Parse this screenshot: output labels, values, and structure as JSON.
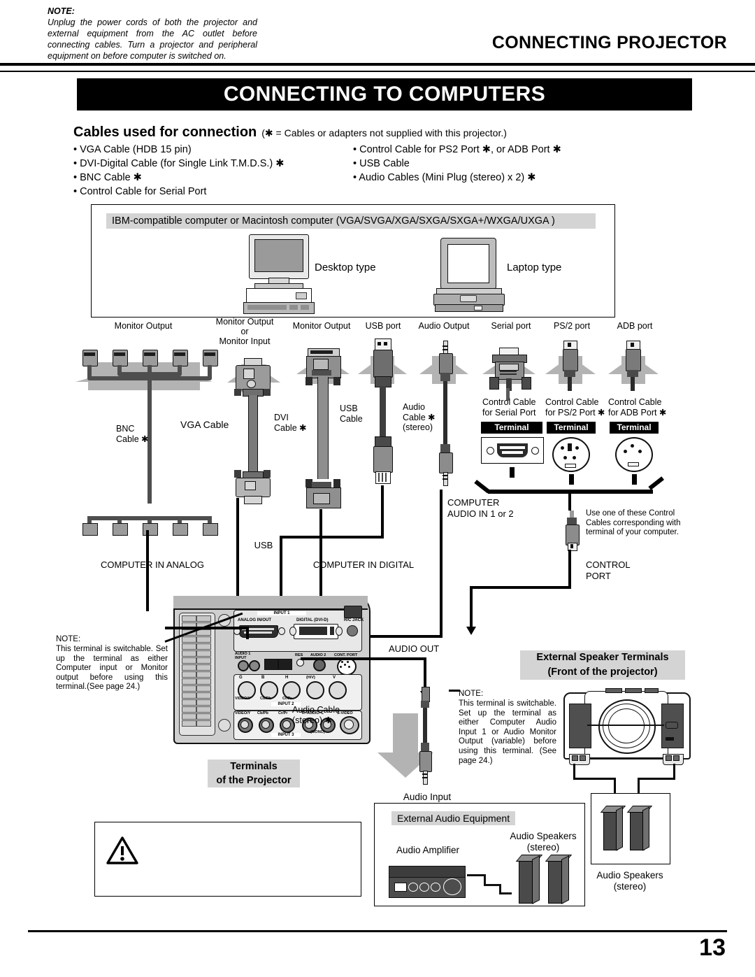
{
  "header": {
    "title": "CONNECTING PROJECTOR",
    "banner": "CONNECTING TO COMPUTERS",
    "page_number": "13"
  },
  "cables_section": {
    "heading": "Cables used for connection",
    "note": "(✱ = Cables or adapters not supplied with this projector.)",
    "left_items": [
      "• VGA Cable (HDB 15 pin)",
      "• DVI-Digital Cable (for Single Link T.M.D.S.) ✱",
      "• BNC Cable ✱",
      "• Control Cable for Serial Port"
    ],
    "right_items": [
      "• Control Cable for PS2 Port ✱, or ADB Port ✱",
      "• USB Cable",
      "• Audio Cables (Mini Plug (stereo) x 2) ✱"
    ]
  },
  "computer_box": {
    "caption": "IBM-compatible computer or Macintosh computer (VGA/SVGA/XGA/SXGA/SXGA+/WXGA/UXGA )",
    "desktop_label": "Desktop type",
    "laptop_label": "Laptop type"
  },
  "ports": [
    {
      "name": "port-monitor-output-bnc",
      "label": "Monitor Output"
    },
    {
      "name": "port-monitor-output-vga",
      "label": "Monitor Output\nor\nMonitor Input"
    },
    {
      "name": "port-monitor-output-dvi",
      "label": "Monitor Output"
    },
    {
      "name": "port-usb",
      "label": "USB port"
    },
    {
      "name": "port-audio-output",
      "label": "Audio Output"
    },
    {
      "name": "port-serial",
      "label": "Serial port"
    },
    {
      "name": "port-ps2",
      "label": "PS/2 port"
    },
    {
      "name": "port-adb",
      "label": "ADB port"
    }
  ],
  "cable_labels": {
    "bnc": "BNC\nCable ✱",
    "vga": "VGA Cable",
    "dvi": "DVI\nCable ✱",
    "usb": "USB\nCable",
    "audio": "Audio\nCable ✱\n(stereo)",
    "control_serial": "Control Cable\nfor Serial Port",
    "control_ps2": "Control Cable\nfor PS/2 Port ✱",
    "control_adb": "Control Cable\nfor ADB Port ✱"
  },
  "terminals": {
    "tag": "Terminal",
    "serial_tag": "Terminal",
    "ps2_tag": "Terminal",
    "adb_tag": "Terminal"
  },
  "diagram_labels": {
    "computer_audio_in": "COMPUTER\nAUDIO IN 1 or 2",
    "control_port": "CONTROL\nPORT",
    "control_cable_note": "Use one of these Control Cables corresponding with terminal of your computer.",
    "computer_in_analog": "COMPUTER IN ANALOG",
    "computer_in_digital": "COMPUTER IN DIGITAL",
    "usb": "USB",
    "audio_out": "AUDIO OUT",
    "audio_cable_stereo": "Audio Cable\n(stereo) ✱",
    "audio_input": "Audio Input",
    "terminals_of_projector": "Terminals\nof the Projector",
    "external_speaker_terminals": "External Speaker Terminals\n(Front of the projector)",
    "external_audio_equipment": "External Audio Equipment",
    "audio_amplifier": "Audio Amplifier",
    "audio_speakers_stereo_inner": "Audio Speakers\n(stereo)",
    "audio_speakers_stereo_outer": "Audio Speakers\n(stereo)"
  },
  "panel": {
    "input1": "INPUT 1",
    "analog_in_out": "ANALOG IN/OUT",
    "digital_dvi_d": "DIGITAL (DVI-D)",
    "rc_jack": "R/C JACK",
    "audio1_input": "AUDIO 1 INPUT",
    "reset": "RES",
    "audio2": "AUDIO 2",
    "control_port": "CONT. PORT",
    "rgb_labels": [
      "G",
      "B",
      "H",
      "(H/V)",
      "V"
    ],
    "input2": "INPUT 2",
    "input2_rca": [
      "VIDEO/Y",
      "Cb/Pb",
      "Cr/Pr"
    ],
    "input3": "INPUT 3",
    "input3_labels": [
      "VIDEO/Y",
      "Cb/Pb",
      "Cr/Pr",
      "R–AUDIO–L",
      "S-VIDEO"
    ],
    "mono": "(MONO)"
  },
  "notes": {
    "left_note_title": "NOTE:",
    "left_note_body": "This terminal is switchable. Set up the terminal as either Computer input or Monitor output before using this terminal.(See page 24.)",
    "right_note_title": "NOTE:",
    "right_note_body": "This terminal is switchable. Set up the terminal as either Computer Audio Input 1 or Audio Monitor Output (variable) before using this terminal. (See page 24.)",
    "bottom_note_title": "NOTE:",
    "bottom_note_body": "Unplug the power cords of both the projector and external equipment from the AC outlet before connecting cables. Turn a projector and peripheral equipment on before computer is switched on."
  }
}
